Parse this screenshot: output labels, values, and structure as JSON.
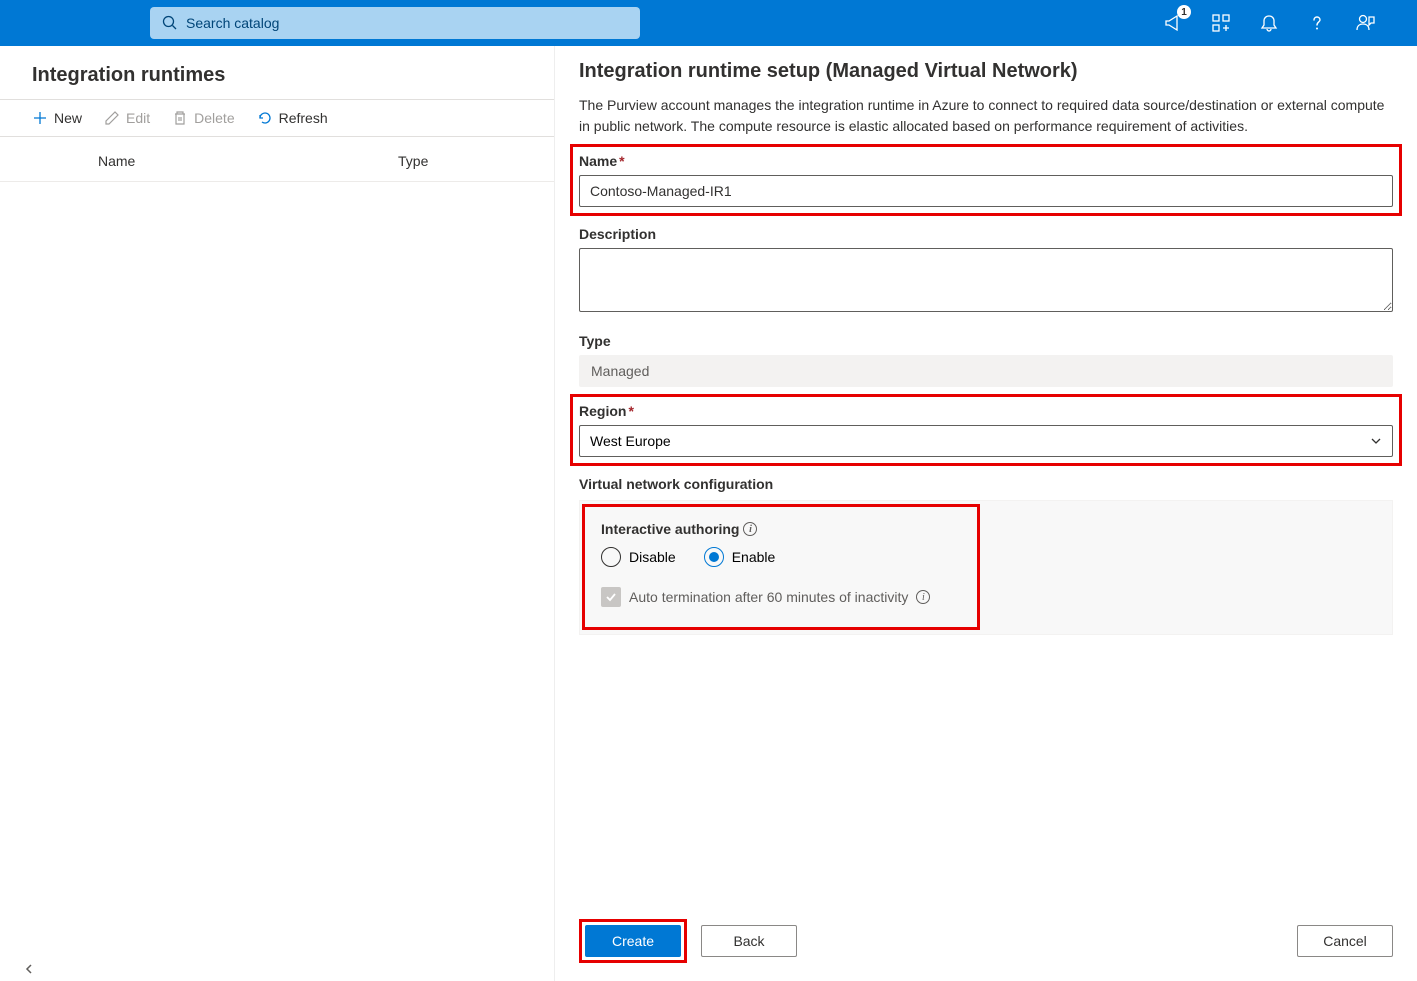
{
  "search": {
    "placeholder": "Search catalog"
  },
  "notification_badge": "1",
  "left": {
    "title": "Integration runtimes",
    "toolbar": {
      "new": "New",
      "edit": "Edit",
      "delete": "Delete",
      "refresh": "Refresh"
    },
    "columns": {
      "name": "Name",
      "type": "Type"
    }
  },
  "blade": {
    "title": "Integration runtime setup (Managed Virtual Network)",
    "description": "The Purview account manages the integration runtime in Azure to connect to required data source/destination or external compute in public network. The compute resource is elastic allocated based on performance requirement of activities.",
    "name_label": "Name",
    "name_value": "Contoso-Managed-IR1",
    "description_label": "Description",
    "description_value": "",
    "type_label": "Type",
    "type_value": "Managed",
    "region_label": "Region",
    "region_value": "West Europe",
    "vnet_section": "Virtual network configuration",
    "interactive_label": "Interactive authoring",
    "radio_disable": "Disable",
    "radio_enable": "Enable",
    "auto_term": "Auto termination after 60 minutes of inactivity",
    "create": "Create",
    "back": "Back",
    "cancel": "Cancel"
  }
}
